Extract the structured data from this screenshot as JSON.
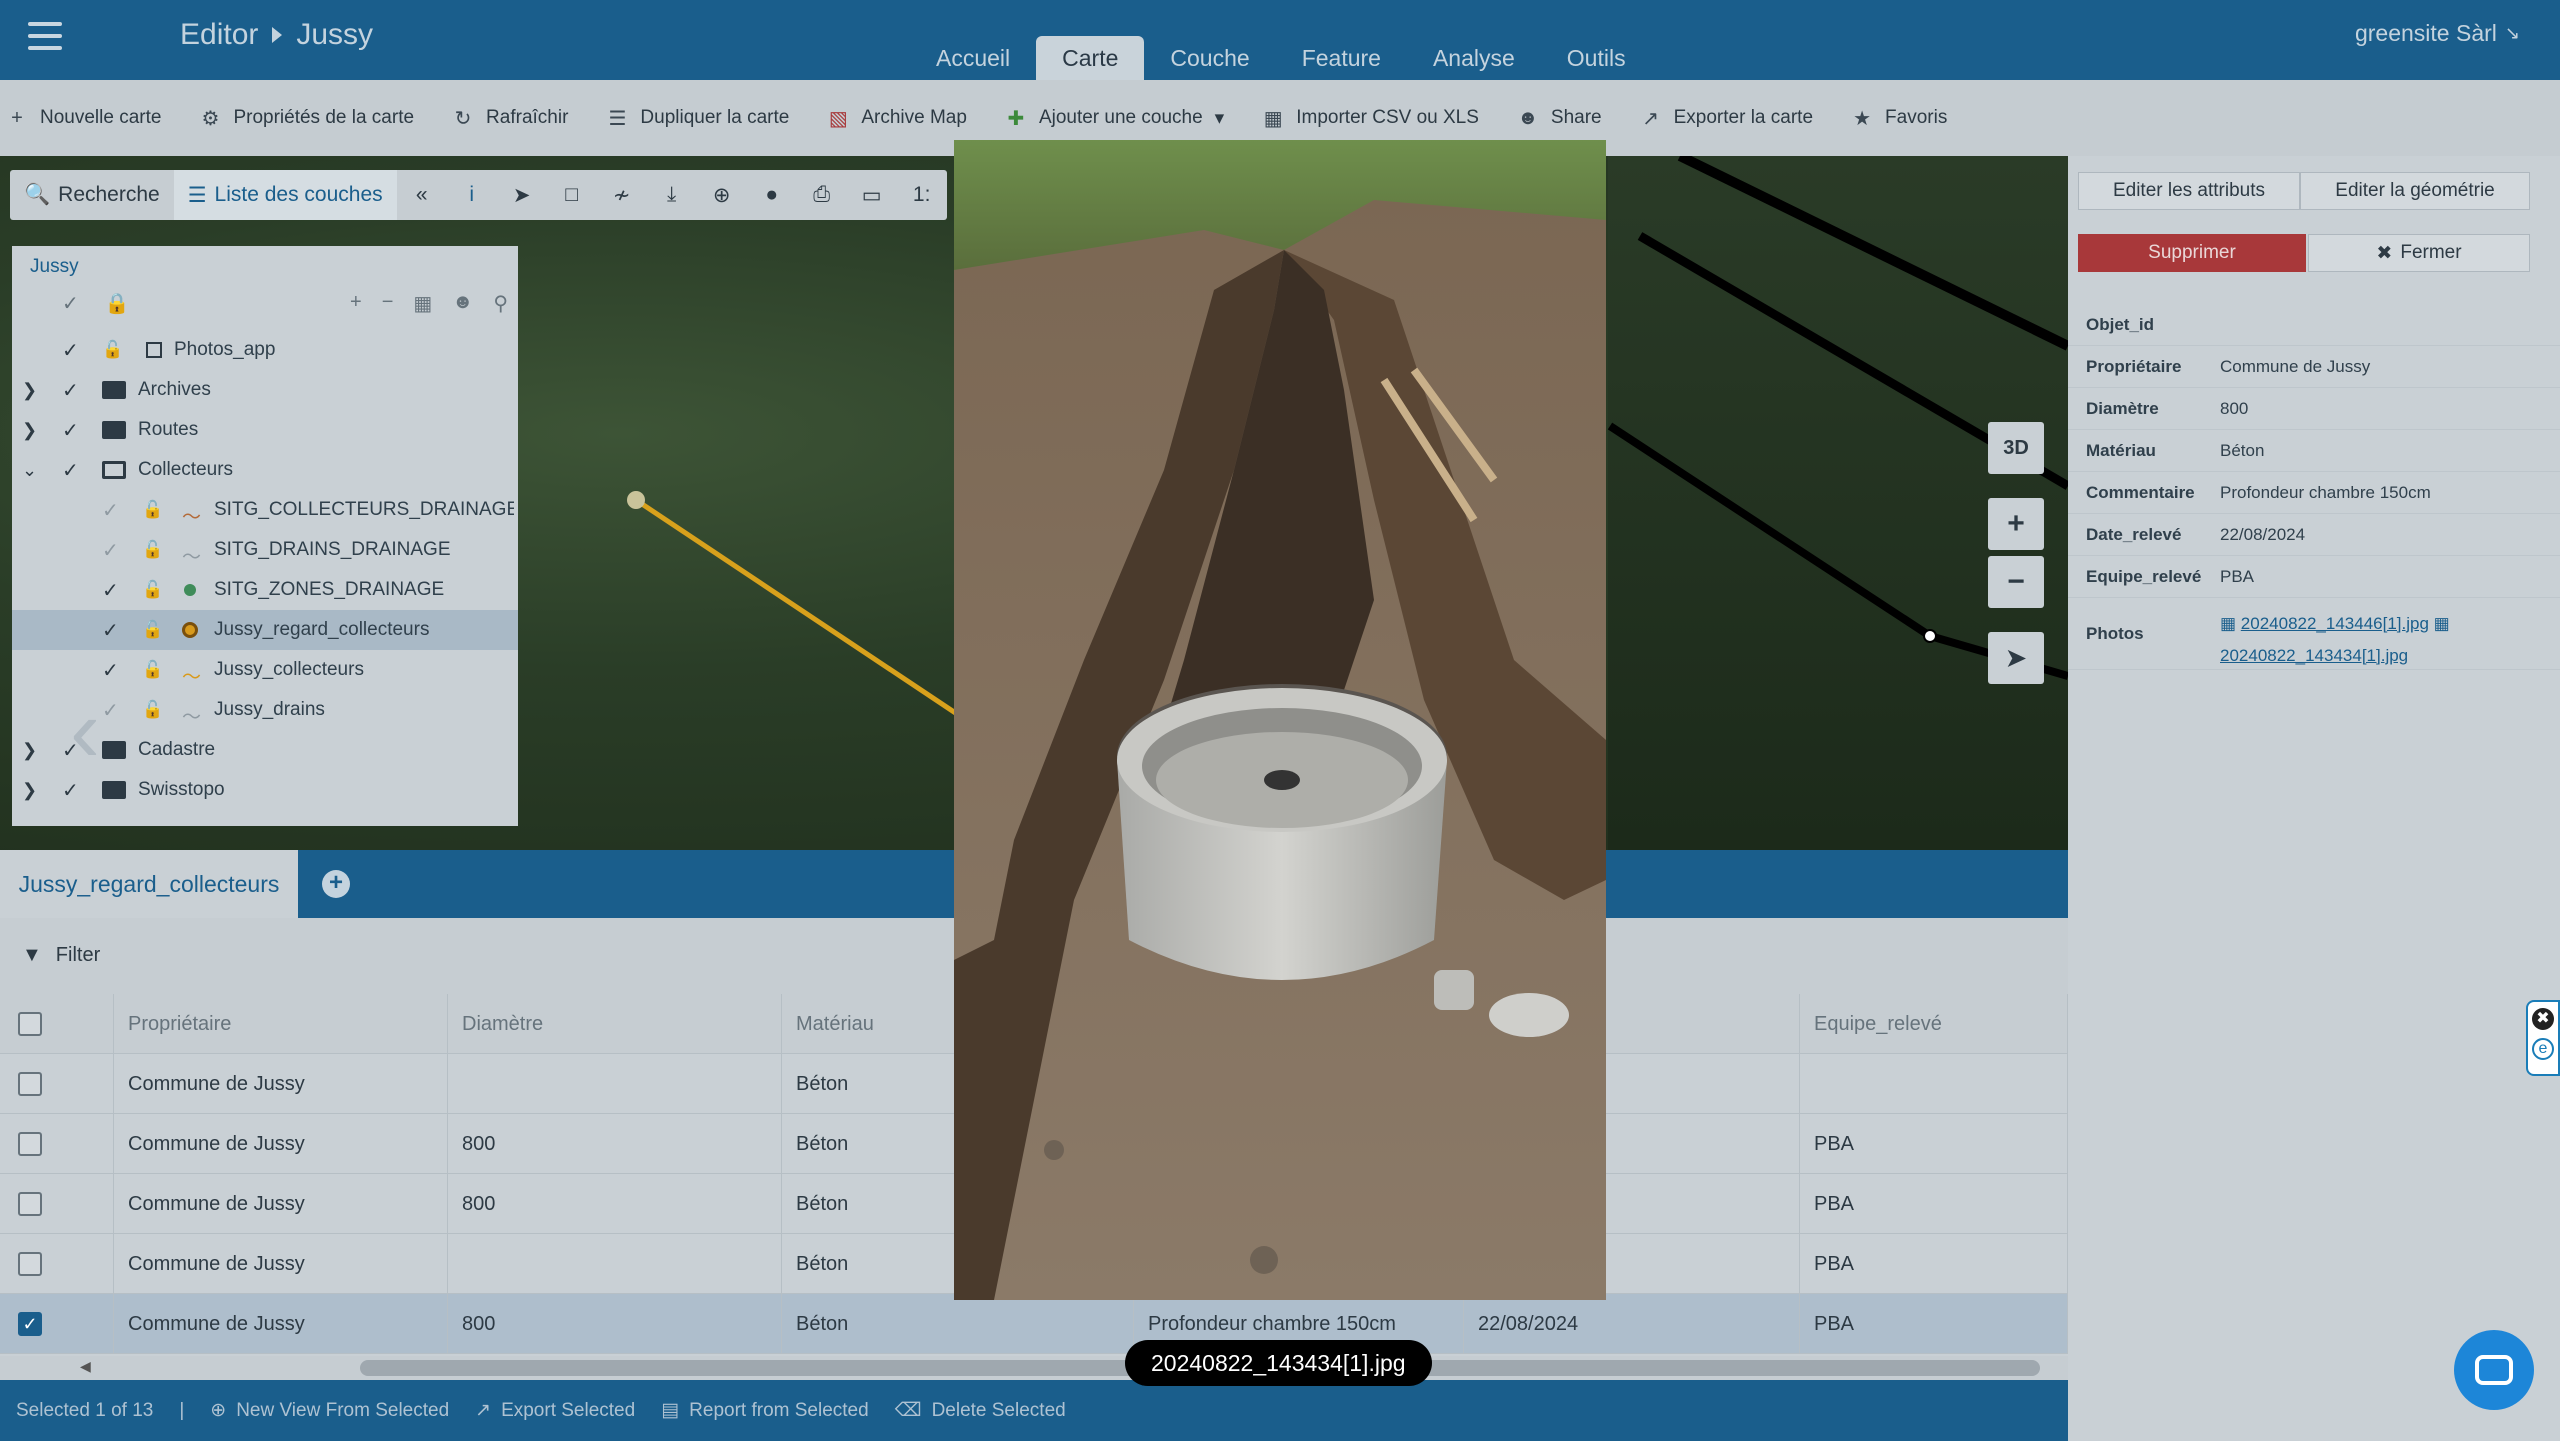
{
  "header": {
    "app": "Editor",
    "project": "Jussy",
    "tabs": [
      "Accueil",
      "Carte",
      "Couche",
      "Feature",
      "Analyse",
      "Outils"
    ],
    "active_tab": "Carte",
    "user": "greensite Sàrl"
  },
  "toolbar": {
    "items": [
      "Nouvelle carte",
      "Propriétés de la carte",
      "Rafraîchir",
      "Dupliquer la carte",
      "Archive Map",
      "Ajouter une couche",
      "Importer CSV ou XLS",
      "Share",
      "Exporter la carte",
      "Favoris"
    ]
  },
  "maptools": {
    "search": "Recherche",
    "layers": "Liste des couches",
    "scale_prefix": "1:"
  },
  "tree": {
    "root": "Jussy",
    "rows": [
      {
        "label": "Photos_app"
      },
      {
        "label": "Archives"
      },
      {
        "label": "Routes"
      },
      {
        "label": "Collecteurs"
      },
      {
        "label": "SITG_COLLECTEURS_DRAINAGE"
      },
      {
        "label": "SITG_DRAINS_DRAINAGE"
      },
      {
        "label": "SITG_ZONES_DRAINAGE"
      },
      {
        "label": "Jussy_regard_collecteurs"
      },
      {
        "label": "Jussy_collecteurs"
      },
      {
        "label": "Jussy_drains"
      },
      {
        "label": "Cadastre"
      },
      {
        "label": "Swisstopo"
      }
    ]
  },
  "map": {
    "btn3d": "3D"
  },
  "panel": {
    "edit_attrs": "Editer les attributs",
    "edit_geom": "Editer la géométrie",
    "delete": "Supprimer",
    "close": "Fermer",
    "attrs": [
      {
        "k": "Objet_id",
        "v": ""
      },
      {
        "k": "Propriétaire",
        "v": "Commune de Jussy"
      },
      {
        "k": "Diamètre",
        "v": "800"
      },
      {
        "k": "Matériau",
        "v": "Béton"
      },
      {
        "k": "Commentaire",
        "v": "Profondeur chambre 150cm"
      },
      {
        "k": "Date_relevé",
        "v": "22/08/2024"
      },
      {
        "k": "Equipe_relevé",
        "v": "PBA"
      }
    ],
    "photos_label": "Photos",
    "photo1": "20240822_143446[1].jpg",
    "photo2": "20240822_143434[1].jpg"
  },
  "table": {
    "layer_tab": "Jussy_regard_collecteurs",
    "filter": "Filter",
    "headers": [
      "Propriétaire",
      "Diamètre",
      "Matériau",
      "Equipe_relevé"
    ],
    "rows": [
      {
        "owner": "Commune de Jussy",
        "diam": "",
        "mat": "Béton",
        "comment": "",
        "date": "",
        "team": ""
      },
      {
        "owner": "Commune de Jussy",
        "diam": "800",
        "mat": "Béton",
        "comment": "",
        "date": "",
        "team": "PBA"
      },
      {
        "owner": "Commune de Jussy",
        "diam": "800",
        "mat": "Béton",
        "comment": "",
        "date": "",
        "team": "PBA"
      },
      {
        "owner": "Commune de Jussy",
        "diam": "",
        "mat": "Béton",
        "comment": "",
        "date": "",
        "team": "PBA"
      },
      {
        "owner": "Commune de Jussy",
        "diam": "800",
        "mat": "Béton",
        "comment": "Profondeur chambre 150cm",
        "date": "22/08/2024",
        "team": "PBA"
      }
    ]
  },
  "status": {
    "selected": "Selected 1 of 13",
    "new_view": "New View From Selected",
    "export": "Export Selected",
    "report": "Report from Selected",
    "delete": "Delete Selected"
  },
  "lightbox": {
    "caption": "20240822_143434[1].jpg"
  }
}
